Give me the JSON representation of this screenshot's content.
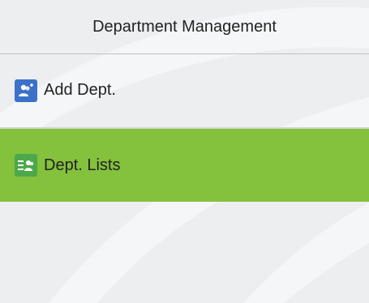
{
  "header": {
    "title": "Department Management"
  },
  "menu": {
    "items": [
      {
        "label": "Add Dept.",
        "icon": "add-user-icon",
        "selected": false
      },
      {
        "label": "Dept. Lists",
        "icon": "user-list-icon",
        "selected": true
      }
    ]
  },
  "colors": {
    "background": "#eceef0",
    "selected": "#84c13c",
    "add_icon_bg": "#3b72c8",
    "list_icon_bg": "#4ca84a"
  }
}
